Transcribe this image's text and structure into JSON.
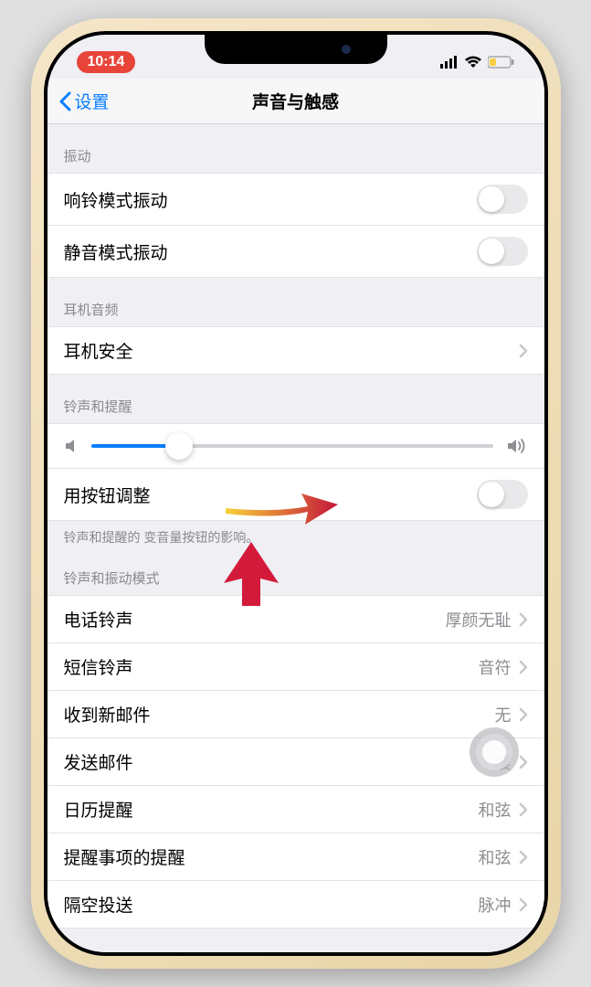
{
  "statusBar": {
    "time": "10:14"
  },
  "nav": {
    "back": "设置",
    "title": "声音与触感"
  },
  "sections": {
    "vibration": {
      "header": "振动",
      "ringVibrate": "响铃模式振动",
      "silentVibrate": "静音模式振动"
    },
    "headphone": {
      "header": "耳机音频",
      "safety": "耳机安全"
    },
    "ringer": {
      "header": "铃声和提醒",
      "buttonAdjust": "用按钮调整",
      "footer": "铃声和提醒的         变音量按钮的影响。"
    },
    "sounds": {
      "header": "铃声和振动模式",
      "items": [
        {
          "label": "电话铃声",
          "value": "厚颜无耻"
        },
        {
          "label": "短信铃声",
          "value": "音符"
        },
        {
          "label": "收到新邮件",
          "value": "无"
        },
        {
          "label": "发送邮件",
          "value": "嗖"
        },
        {
          "label": "日历提醒",
          "value": "和弦"
        },
        {
          "label": "提醒事项的提醒",
          "value": "和弦"
        },
        {
          "label": "隔空投送",
          "value": "脉冲"
        }
      ]
    }
  }
}
